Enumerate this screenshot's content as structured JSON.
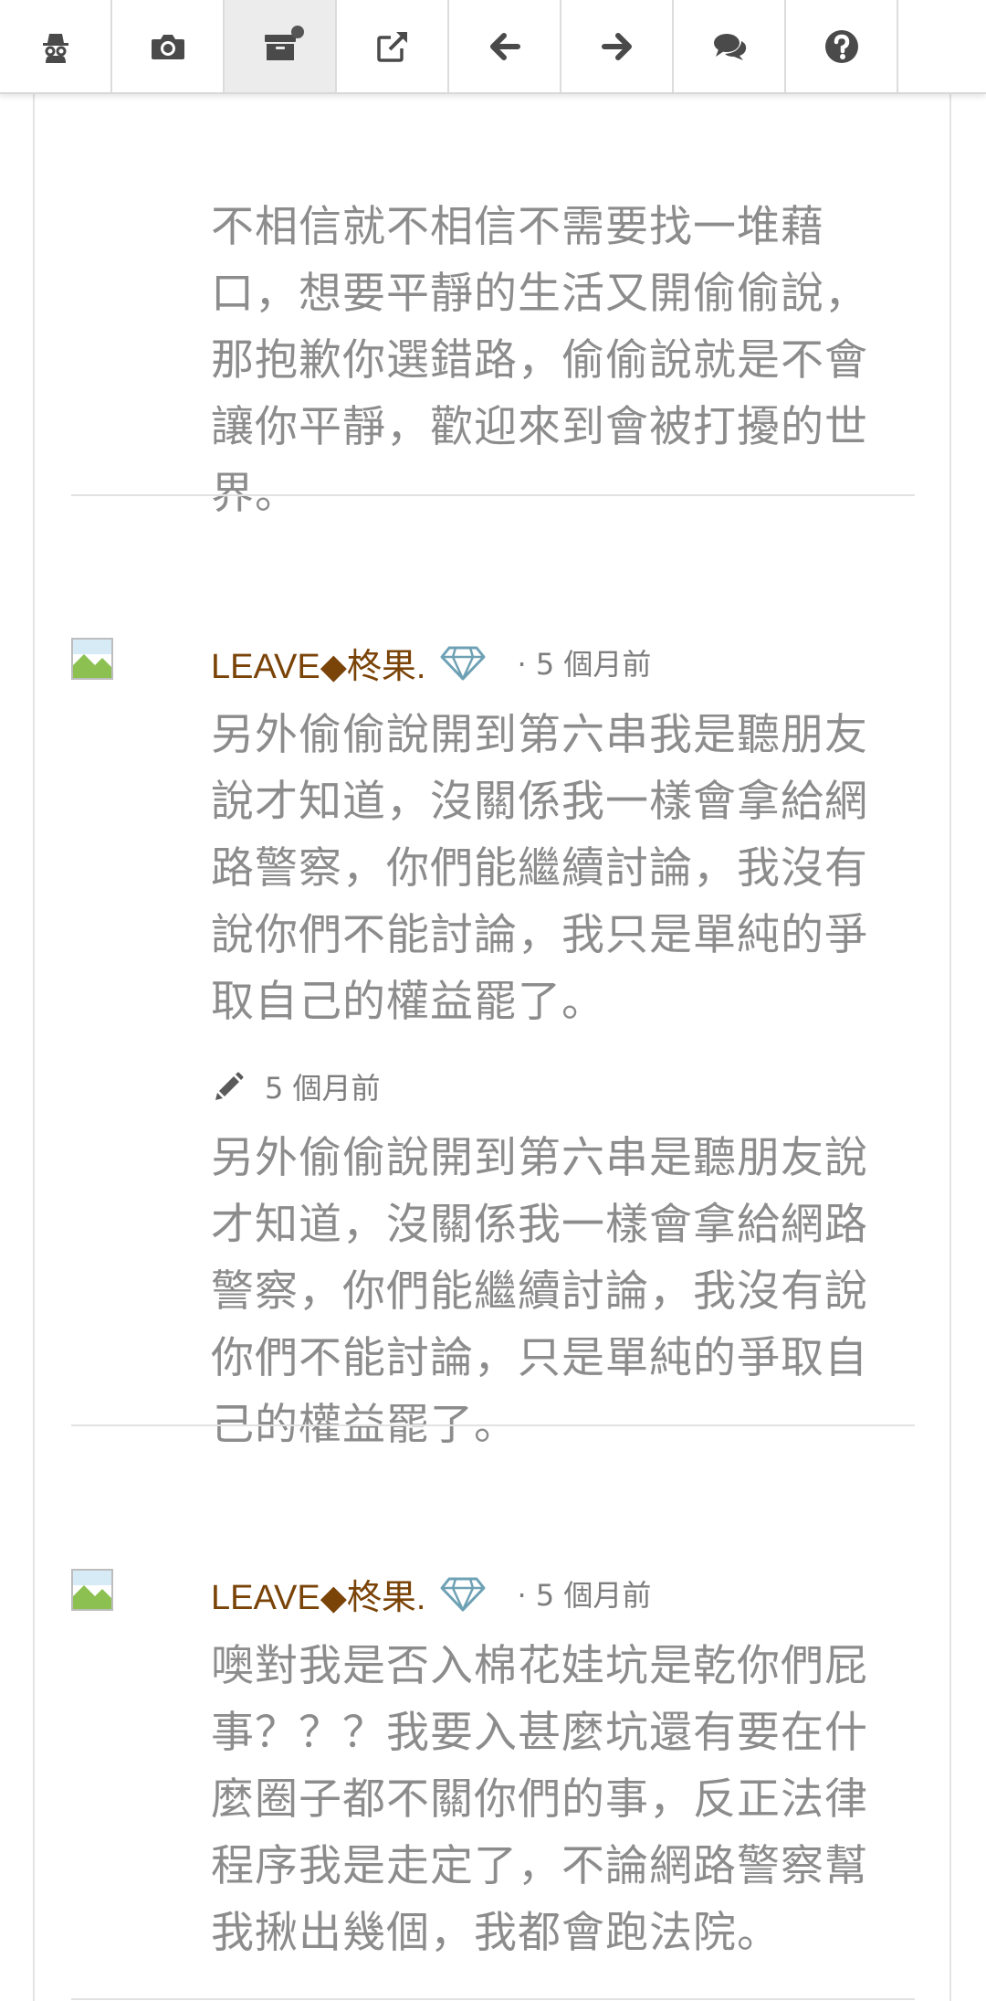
{
  "toolbar": {
    "buttons": [
      {
        "icon": "incognito-icon",
        "active": false
      },
      {
        "icon": "camera-icon",
        "active": false
      },
      {
        "icon": "archive-icon",
        "active": true,
        "has_badge": true
      },
      {
        "icon": "external-link-icon",
        "active": false
      },
      {
        "icon": "arrow-left-icon",
        "active": false
      },
      {
        "icon": "arrow-right-icon",
        "active": false
      },
      {
        "icon": "comments-icon",
        "active": false
      },
      {
        "icon": "help-icon",
        "active": false
      }
    ]
  },
  "top_comment_tail": {
    "text": "不相信就不相信不需要找一堆藉口，想要平靜的生活又開偷偷說，那抱歉你選錯路，偷偷說就是不會讓你平靜，歡迎來到會被打擾的世界。"
  },
  "comments": [
    {
      "username": "LEAVE◆柊果.",
      "time": "· 5 個月前",
      "text": "另外偷偷說開到第六串我是聽朋友說才知道，沒關係我一樣會拿給網路警察，你們能繼續討論，我沒有說你們不能討論，我只是單純的爭取自己的權益罷了。",
      "edit": {
        "time": "5 個月前",
        "text": "另外偷偷說開到第六串是聽朋友說才知道，沒關係我一樣會拿給網路警察，你們能繼續討論，我沒有說你們不能討論，只是單純的爭取自己的權益罷了。"
      }
    },
    {
      "username": "LEAVE◆柊果.",
      "time": "· 5 個月前",
      "text": "噢對我是否入棉花娃坑是乾你們屁事？？？我要入甚麼坑還有要在什麼圈子都不關你們的事，反正法律程序我是走定了，不論網路警察幫我揪出幾個，我都會跑法院。"
    }
  ],
  "colors": {
    "username": "#7a4308",
    "body_text": "#8c8c8c",
    "meta_text": "#7d7d7d",
    "vip_icon": "#6fa1b5",
    "toolbar_icon": "#4a4a4a"
  }
}
